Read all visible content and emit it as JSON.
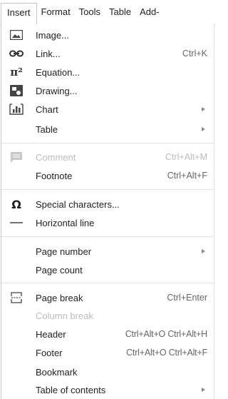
{
  "menubar": {
    "items": [
      {
        "label": "Insert"
      },
      {
        "label": "Format"
      },
      {
        "label": "Tools"
      },
      {
        "label": "Table"
      },
      {
        "label": "Add-"
      }
    ]
  },
  "menu": {
    "items": [
      {
        "label": "Image...",
        "icon": "image-icon"
      },
      {
        "label": "Link...",
        "shortcut": "Ctrl+K",
        "icon": "link-icon"
      },
      {
        "label": "Equation...",
        "icon": "equation-icon",
        "icon_text": "π²"
      },
      {
        "label": "Drawing...",
        "icon": "drawing-icon"
      },
      {
        "label": "Chart",
        "submenu": true,
        "icon": "chart-icon"
      },
      {
        "label": "Table",
        "submenu": true
      },
      {
        "label": "Comment",
        "shortcut": "Ctrl+Alt+M",
        "disabled": true,
        "icon": "comment-icon"
      },
      {
        "label": "Footnote",
        "shortcut": "Ctrl+Alt+F"
      },
      {
        "label": "Special characters...",
        "icon": "omega-icon",
        "icon_text": "Ω"
      },
      {
        "label": "Horizontal line",
        "icon": "horizontal-line-icon"
      },
      {
        "label": "Page number",
        "submenu": true
      },
      {
        "label": "Page count"
      },
      {
        "label": "Page break",
        "shortcut": "Ctrl+Enter",
        "icon": "page-break-icon"
      },
      {
        "label": "Column break",
        "disabled": true
      },
      {
        "label": "Header",
        "shortcut": "Ctrl+Alt+O Ctrl+Alt+H"
      },
      {
        "label": "Footer",
        "shortcut": "Ctrl+Alt+O Ctrl+Alt+F"
      },
      {
        "label": "Bookmark"
      },
      {
        "label": "Table of contents",
        "submenu": true
      }
    ]
  },
  "colors": {
    "text": "#222222",
    "disabled_text": "#bdbdbd",
    "shortcut_text": "#666666",
    "icon": "#444444"
  }
}
